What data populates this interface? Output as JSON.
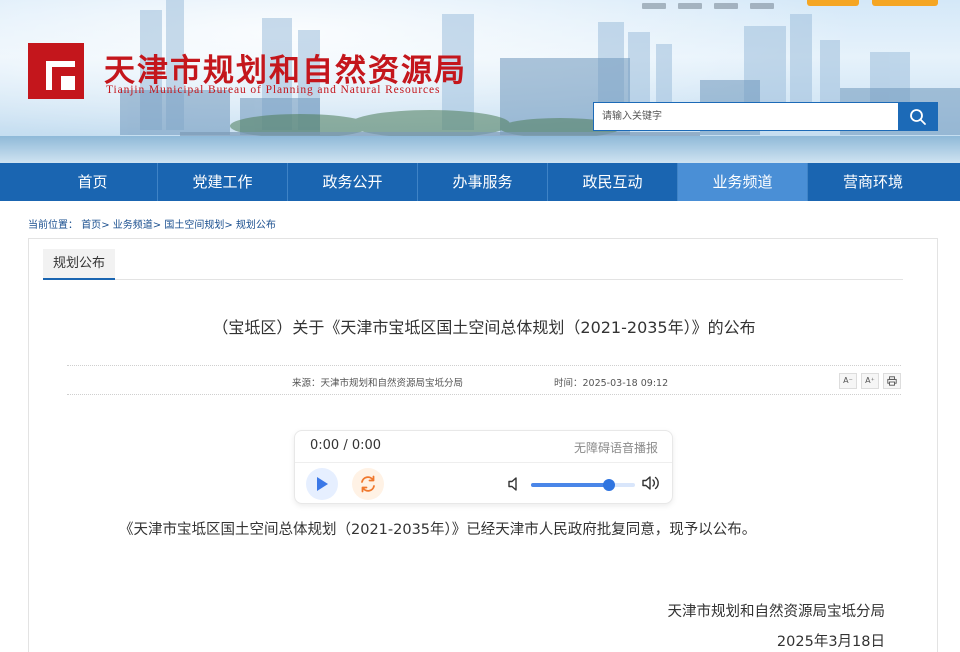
{
  "header": {
    "title": "天津市规划和自然资源局",
    "subtitle": "Tianjin Municipal Bureau of Planning and Natural Resources",
    "search": {
      "placeholder": "请输入关键字"
    },
    "brand_color": "#c4161c"
  },
  "nav": {
    "items": [
      {
        "label": "首页",
        "active": false
      },
      {
        "label": "党建工作",
        "active": false
      },
      {
        "label": "政务公开",
        "active": false
      },
      {
        "label": "办事服务",
        "active": false
      },
      {
        "label": "政民互动",
        "active": false
      },
      {
        "label": "业务频道",
        "active": true
      },
      {
        "label": "营商环境",
        "active": false
      }
    ],
    "bg_color": "#1a65b1",
    "active_color": "#4a8fd6"
  },
  "breadcrumb": {
    "prefix": "当前位置：",
    "items": [
      "首页",
      "业务频道",
      "国土空间规划",
      "规划公布"
    ],
    "sep": ">"
  },
  "panel": {
    "tab_label": "规划公布"
  },
  "article": {
    "title": "（宝坻区）关于《天津市宝坻区国土空间总体规划（2021-2035年）》的公布",
    "source": "来源：天津市规划和自然资源局宝坻分局",
    "time": "时间：2025-03-18 09:12",
    "tools": {
      "font_smaller": "A⁻",
      "font_larger": "A⁺",
      "print_icon": "print-icon"
    },
    "body": "《天津市宝坻区国土空间总体规划（2021-2035年）》已经天津市人民政府批复同意，现予以公布。",
    "signature": "天津市规划和自然资源局宝坻分局",
    "date": "2025年3月18日"
  },
  "player": {
    "time": "0:00 / 0:00",
    "tag": "无障碍语音播报",
    "volume": 0.75,
    "icons": [
      "play-icon",
      "loop-icon",
      "volume-low-icon",
      "volume-high-icon"
    ]
  }
}
